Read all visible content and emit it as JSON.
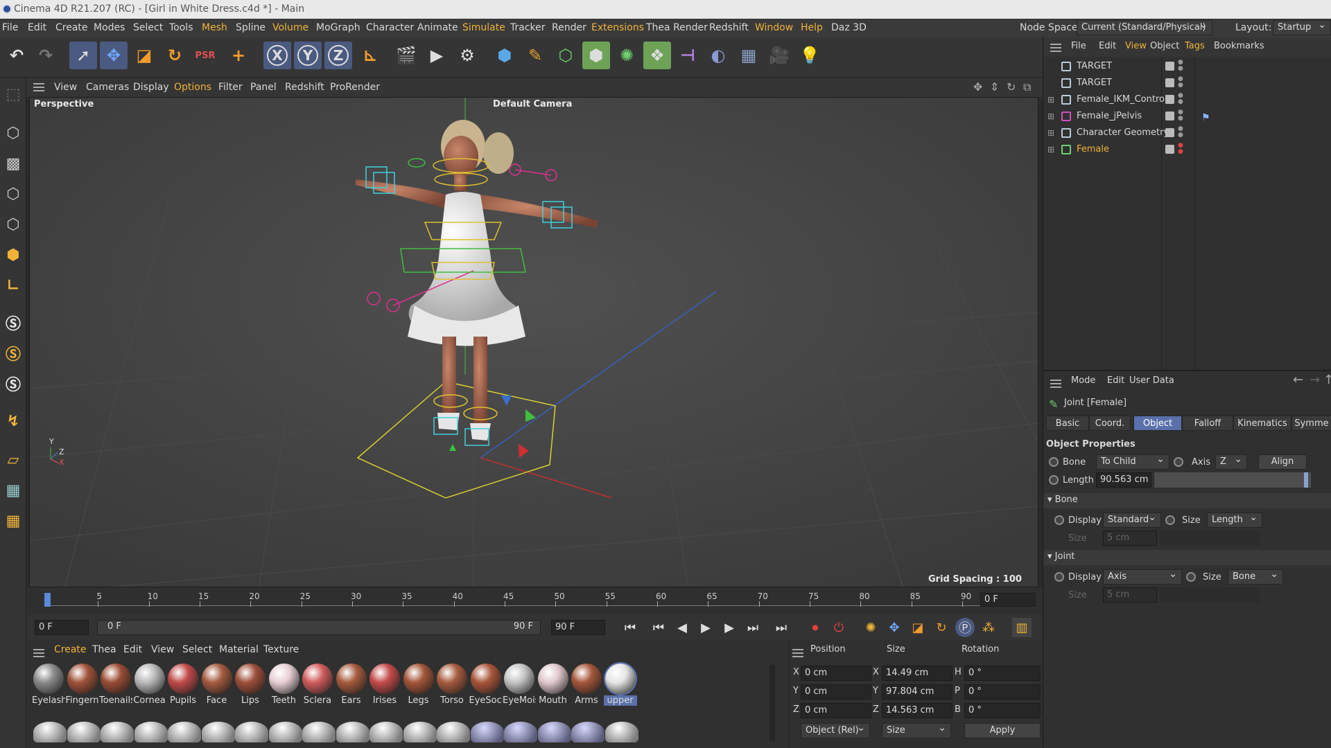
{
  "window": {
    "title": "Cinema 4D R21.207 (RC) - [Girl in White Dress.c4d *] - Main"
  },
  "menu": {
    "items": [
      "File",
      "Edit",
      "Create",
      "Modes",
      "Select",
      "Tools",
      "Mesh",
      "Spline",
      "Volume",
      "MoGraph",
      "Character",
      "Animate",
      "Simulate",
      "Tracker",
      "Render",
      "Extensions",
      "Thea Render",
      "Redshift",
      "Window",
      "Help",
      "Daz 3D"
    ],
    "node_space_label": "Node Space:",
    "node_space_value": "Current (Standard/Physical)",
    "layout_label": "Layout:",
    "layout_value": "Startup"
  },
  "toolbar": {
    "axis_x": "X",
    "axis_y": "Y",
    "axis_z": "Z"
  },
  "viewport_menu": [
    "View",
    "Cameras",
    "Display",
    "Options",
    "Filter",
    "Panel",
    "Redshift",
    "ProRender"
  ],
  "viewport": {
    "view_name": "Perspective",
    "camera": "Default Camera",
    "grid_spacing": "Grid Spacing : 100 cm",
    "axis_y": "Y",
    "axis_z": "Z",
    "axis_x": "X"
  },
  "timeline": {
    "ticks": [
      "0",
      "5",
      "10",
      "15",
      "20",
      "25",
      "30",
      "35",
      "40",
      "45",
      "50",
      "55",
      "60",
      "65",
      "70",
      "75",
      "80",
      "85",
      "90"
    ],
    "current_frame": "0 F"
  },
  "playbar": {
    "start": "0 F",
    "range_start": "0 F",
    "range_end": "90 F",
    "end": "90 F"
  },
  "material_manager": {
    "menu": [
      "Create",
      "Thea",
      "Edit",
      "View",
      "Select",
      "Material",
      "Texture"
    ],
    "materials": [
      {
        "name": "Eyelashe",
        "color": "#8a8a8a"
      },
      {
        "name": "Fingerna",
        "color": "#a0523a"
      },
      {
        "name": "Toenails",
        "color": "#9a4c34"
      },
      {
        "name": "Cornea",
        "color": "#b9b9b9"
      },
      {
        "name": "Pupils",
        "color": "#c14a4a"
      },
      {
        "name": "Face",
        "color": "#a45a3e"
      },
      {
        "name": "Lips",
        "color": "#9e4e3a"
      },
      {
        "name": "Teeth",
        "color": "#e8d0d4"
      },
      {
        "name": "Sclera",
        "color": "#d05c5c"
      },
      {
        "name": "Ears",
        "color": "#a55a3d"
      },
      {
        "name": "Irises",
        "color": "#c44b4b"
      },
      {
        "name": "Legs",
        "color": "#a35538"
      },
      {
        "name": "Torso",
        "color": "#a75b3e"
      },
      {
        "name": "EyeSock",
        "color": "#a9553a"
      },
      {
        "name": "EyeMois",
        "color": "#c5c5c5"
      },
      {
        "name": "Mouth",
        "color": "#e0c8cc"
      },
      {
        "name": "Arms",
        "color": "#a5563b"
      },
      {
        "name": "upper",
        "color": "#e6e6e6"
      }
    ]
  },
  "coordinates": {
    "headers": [
      "Position",
      "Size",
      "Rotation"
    ],
    "rows": [
      {
        "axis": "X",
        "pos": "0 cm",
        "size_axis": "X",
        "size": "14.49 cm",
        "rot_axis": "H",
        "rot": "0 °"
      },
      {
        "axis": "Y",
        "pos": "0 cm",
        "size_axis": "Y",
        "size": "97.804 cm",
        "rot_axis": "P",
        "rot": "0 °"
      },
      {
        "axis": "Z",
        "pos": "0 cm",
        "size_axis": "Z",
        "size": "14.563 cm",
        "rot_axis": "B",
        "rot": "0 °"
      }
    ],
    "mode": "Object (Rel)",
    "size_mode": "Size",
    "apply": "Apply"
  },
  "object_manager": {
    "menu": [
      "File",
      "Edit",
      "View",
      "Object",
      "Tags",
      "Bookmarks"
    ],
    "objects": [
      {
        "name": "TARGET",
        "color": "#d8d8d8"
      },
      {
        "name": "TARGET",
        "color": "#d8d8d8"
      },
      {
        "name": "Female_IKM_Controls",
        "color": "#d8d8d8"
      },
      {
        "name": "Female_jPelvis",
        "color": "#d8d8d8"
      },
      {
        "name": "Character Geometry",
        "color": "#d8d8d8"
      },
      {
        "name": "Female",
        "color": "#f0b33a"
      }
    ]
  },
  "attributes": {
    "menu": [
      "Mode",
      "Edit",
      "User Data"
    ],
    "object_title": "Joint [Female]",
    "tabs": [
      "Basic",
      "Coord.",
      "Object",
      "Falloff",
      "Kinematics",
      "Symme"
    ],
    "active_tab": "Object",
    "section_title": "Object Properties",
    "bone_label": "Bone",
    "bone_value": "To Child",
    "axis_label": "Axis",
    "axis_value": "Z",
    "align": "Align",
    "length_label": "Length",
    "length_value": "90.563 cm",
    "bone_group": "Bone",
    "bone_display_label": "Display",
    "bone_display_value": "Standard",
    "bone_size_label": "Size",
    "bone_size_value": "Length",
    "bone_size2_label": "Size",
    "bone_size2_value": "5 cm",
    "joint_group": "Joint",
    "joint_display_label": "Display",
    "joint_display_value": "Axis",
    "joint_size_label": "Size",
    "joint_size_value": "Bone",
    "joint_size2_label": "Size",
    "joint_size2_value": "5 cm"
  },
  "colors": {
    "accent": "#f0b33a",
    "active_tab": "#5a70aa",
    "green_active": "#6ea357"
  }
}
